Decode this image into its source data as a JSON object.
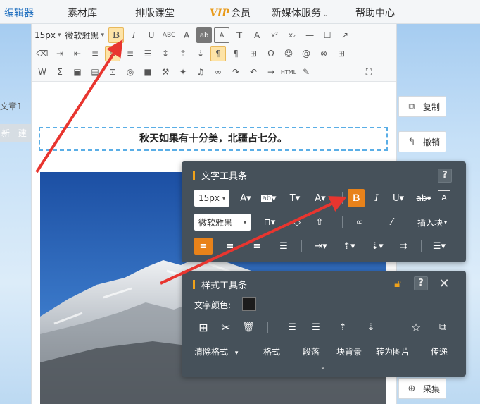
{
  "nav": {
    "items": [
      "编辑器",
      "素材库",
      "排版课堂",
      "新媒体服务",
      "帮助中心"
    ],
    "vip_mark": "VIP",
    "vip_label": "会员"
  },
  "left_rail": {
    "article_label": "文章1",
    "new_button": "新 建"
  },
  "toolbar": {
    "font_size": "15px",
    "font_family": "微软雅黑"
  },
  "article": {
    "headline": "秋天如果有十分美，北疆占七分。"
  },
  "side_buttons": {
    "copy": "复制",
    "undo": "撤销",
    "collect": "采集"
  },
  "text_toolbar": {
    "title": "文字工具条",
    "help": "?",
    "font_size": "15px",
    "font_family": "微软雅黑",
    "insert_block": "插入块"
  },
  "style_toolbar": {
    "title": "样式工具条",
    "help": "?",
    "text_color_label": "文字颜色:",
    "text_color": "#1c1c1c",
    "actions": [
      "清除格式",
      "格式",
      "段落",
      "块背景",
      "转为图片",
      "传递"
    ]
  },
  "colors": {
    "accent_orange": "#e8821a",
    "panel_bg": "#46515a",
    "annotation_red": "#e8352f",
    "headline_border": "#5aaee6"
  }
}
